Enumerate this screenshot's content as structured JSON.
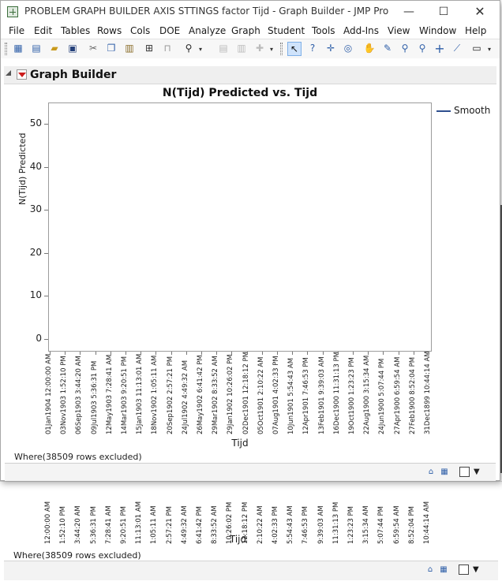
{
  "window": {
    "title": "PROBLEM GRAPH BUILDER AXIS STTINGS factor Tijd - Graph Builder - JMP Pro",
    "minimize_glyph": "—",
    "maximize_glyph": "☐",
    "close_glyph": "✕"
  },
  "menu": [
    "File",
    "Edit",
    "Tables",
    "Rows",
    "Cols",
    "DOE",
    "Analyze",
    "Graph",
    "Student",
    "Tools",
    "Add-Ins",
    "View",
    "Window",
    "Help"
  ],
  "toolbar": {
    "icons": [
      "new-table-icon",
      "new-script-icon",
      "open-icon",
      "save-icon",
      "cut-icon",
      "copy-icon",
      "paste-icon",
      "data-table-icon",
      "lock-icon",
      "search-icon",
      "journal-icon",
      "layout-icon",
      "add-icon",
      "arrow-icon",
      "help-icon",
      "crosshair-icon",
      "lasso-icon",
      "hand-icon",
      "brush-icon",
      "magnifier-icon",
      "zoom-icon",
      "plus-icon",
      "line-icon",
      "annotate-icon"
    ]
  },
  "outline": {
    "title": "Graph Builder"
  },
  "chart_data": {
    "type": "line",
    "title": "N(Tijd)  Predicted vs. Tijd",
    "xlabel": "Tijd",
    "ylabel": "N(Tijd) Predicted",
    "ylim": [
      -3,
      55
    ],
    "yticks": [
      0,
      10,
      20,
      30,
      40,
      50
    ],
    "x_tick_labels": [
      "01Jan1904 12:00:00 AM",
      "03Nov1903 1:52:10 PM",
      "06Sep1903 3:44:20 AM",
      "09Jul1903 5:36:31 PM",
      "12May1903 7:28:41 AM",
      "14Mar1903 9:20:51 PM",
      "15Jan1903 11:13:01 AM",
      "18Nov1902 1:05:11 AM",
      "20Sep1902 2:57:21 PM",
      "24Jul1902 4:49:32 AM",
      "26May1902 6:41:42 PM",
      "29Mar1902 8:33:52 AM",
      "29Jan1902 10:26:02 PM",
      "02Dec1901 12:18:12 PM",
      "05Oct1901 2:10:22 AM",
      "07Aug1901 4:02:33 PM",
      "10Jun1901 5:54:43 AM",
      "12Apr1901 7:46:53 PM",
      "13Feb1901 9:39:03 AM",
      "16Dec1900 11:31:13 PM",
      "19Oct1900 1:23:23 PM",
      "22Aug1900 3:15:34 AM",
      "24Jun1900 5:07:44 PM",
      "27Apr1900 6:59:54 AM",
      "27Feb1900 8:52:04 PM",
      "31Dec1899 10:44:14 AM"
    ],
    "series": [
      {
        "name": "Smooth",
        "values": [],
        "color": "#2f4f8f"
      }
    ],
    "grid": false,
    "legend": "right"
  },
  "where_note": "Where(38509 rows excluded)",
  "background_window": {
    "x_tick_labels": [
      "12:00:00 AM",
      "1:52:10 PM",
      "3:44:20 AM",
      "5:36:31 PM",
      "7:28:41 AM",
      "9:20:51 PM",
      "11:13:01 AM",
      "1:05:11 AM",
      "2:57:21 PM",
      "4:49:32 AM",
      "6:41:42 PM",
      "8:33:52 AM",
      "10:26:02 PM",
      "12:18:12 PM",
      "2:10:22 AM",
      "4:02:33 PM",
      "5:54:43 AM",
      "7:46:53 PM",
      "9:39:03 AM",
      "11:31:13 PM",
      "1:23:23 PM",
      "3:15:34 AM",
      "5:07:44 PM",
      "6:59:54 AM",
      "8:52:04 PM",
      "10:44:14 AM"
    ],
    "xlabel": "Tijd",
    "where_note": "Where(38509 rows excluded)"
  },
  "statusbar": {
    "drop_glyph": "▼"
  }
}
